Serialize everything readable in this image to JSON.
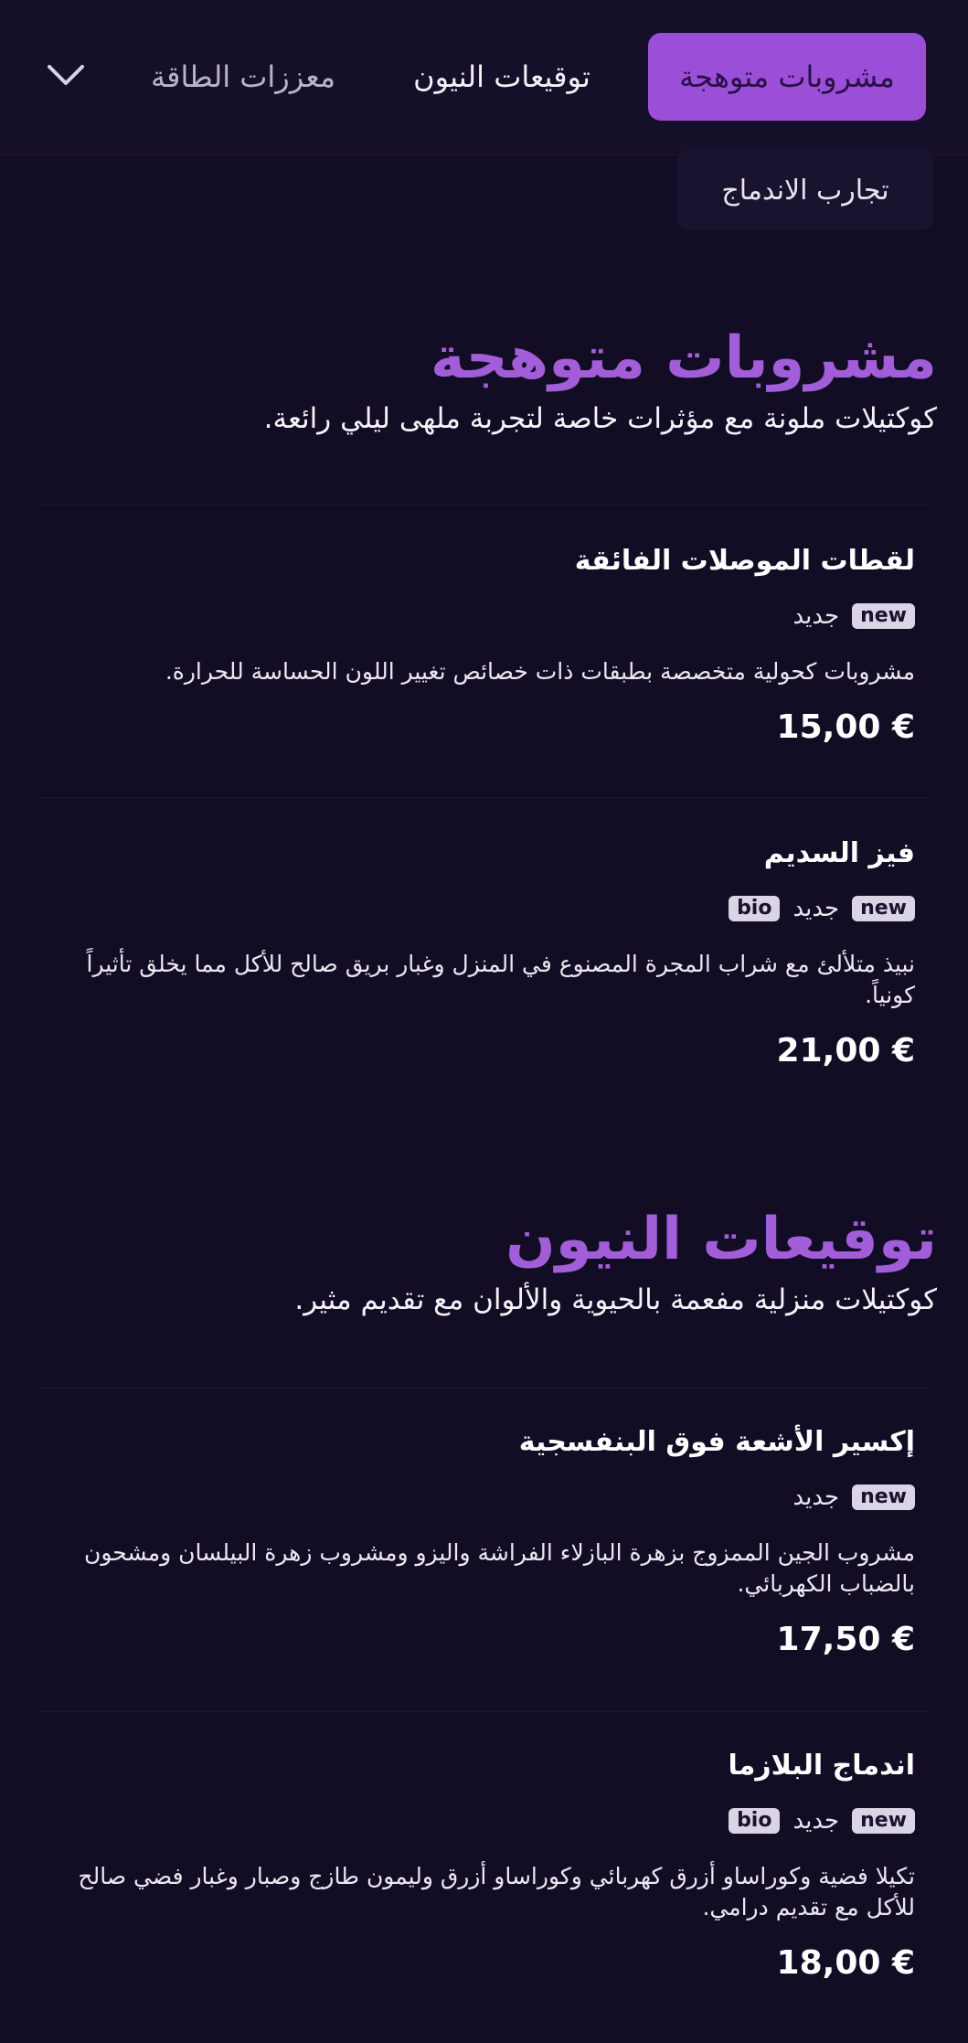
{
  "nav": {
    "tabs": [
      {
        "label": "مشروبات متوهجة",
        "active": true
      },
      {
        "label": "توقيعات النيون",
        "active": false
      },
      {
        "label": "معززات الطاقة",
        "active": false
      },
      {
        "label": "تجارب الاندماج",
        "active": false
      }
    ],
    "expand_icon": "chevron-down-icon"
  },
  "sections": [
    {
      "title": "مشروبات متوهجة",
      "subtitle": "كوكتيلات ملونة مع مؤثرات خاصة لتجربة ملهى ليلي رائعة.",
      "items": [
        {
          "name": "لقطات الموصلات الفائقة",
          "badges": [
            "new"
          ],
          "tag_label": "جديد",
          "description": "مشروبات كحولية متخصصة بطبقات ذات خصائص تغيير اللون الحساسة للحرارة.",
          "price": "15,00 €"
        },
        {
          "name": "فيز السديم",
          "badges": [
            "new",
            "bio"
          ],
          "tag_label": "جديد",
          "description": "نبيذ متلألئ مع شراب المجرة المصنوع في المنزل وغبار بريق صالح للأكل مما يخلق تأثيراً كونياً.",
          "price": "21,00 €"
        }
      ]
    },
    {
      "title": "توقيعات النيون",
      "subtitle": "كوكتيلات منزلية مفعمة بالحيوية والألوان مع تقديم مثير.",
      "items": [
        {
          "name": "إكسير الأشعة فوق البنفسجية",
          "badges": [
            "new"
          ],
          "tag_label": "جديد",
          "description": "مشروب الجين الممزوج بزهرة البازلاء الفراشة واليزو ومشروب زهرة البيلسان ومشحون بالضباب الكهربائي.",
          "price": "17,50 €"
        },
        {
          "name": "اندماج البلازما",
          "badges": [
            "new",
            "bio"
          ],
          "tag_label": "جديد",
          "description": "تكيلا فضية وكوراساو أزرق كهربائي وكوراساو أزرق وليمون طازج وصبار وغبار فضي صالح للأكل مع تقديم درامي.",
          "price": "18,00 €"
        }
      ]
    }
  ],
  "colors": {
    "background": "#130c25",
    "accent": "#9b4fd8",
    "heading": "#a25ed9",
    "badge": "#d9d4e6"
  }
}
